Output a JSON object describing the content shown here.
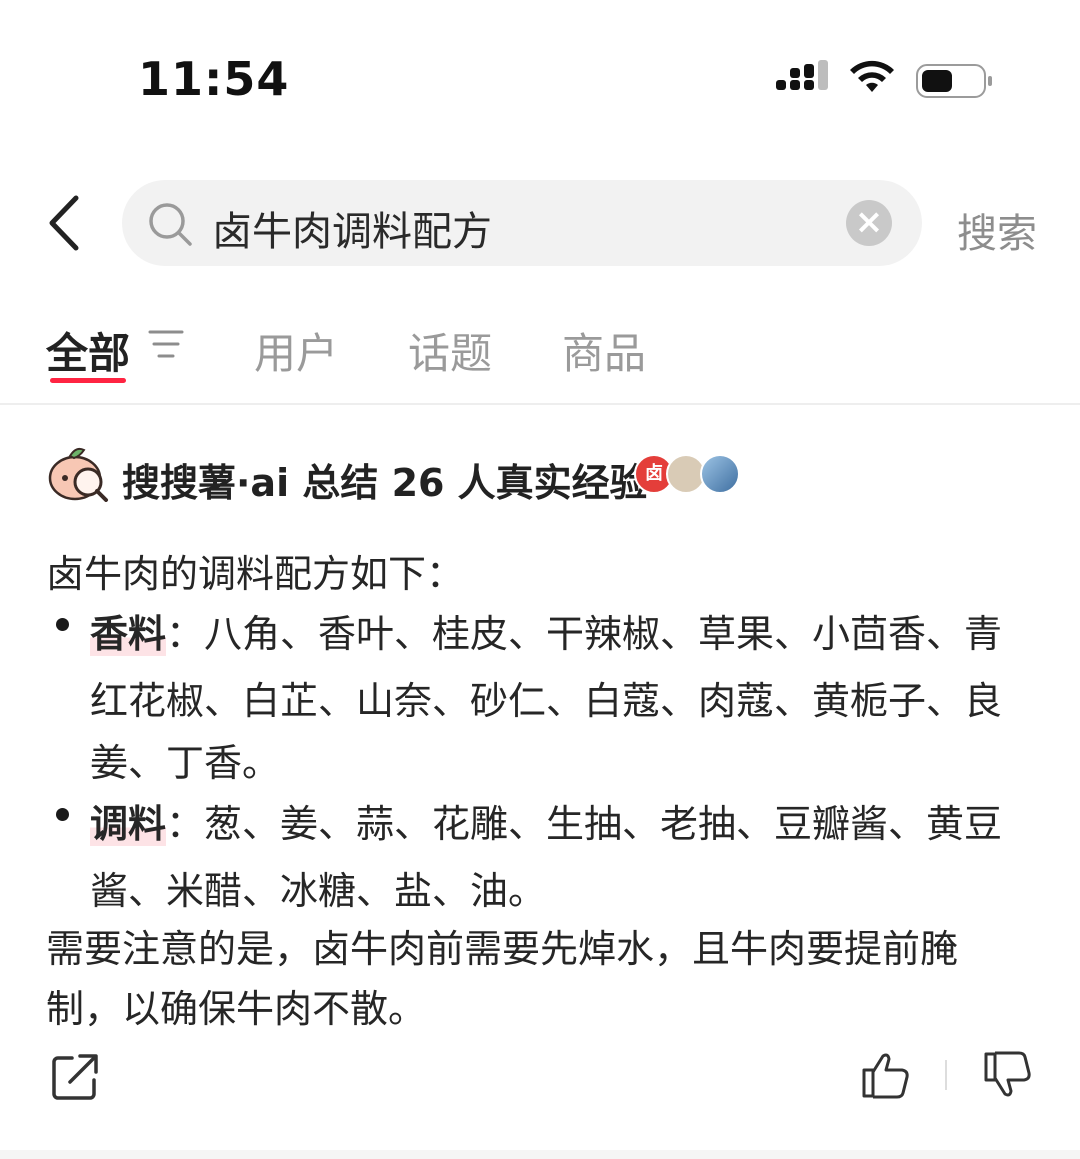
{
  "status_bar": {
    "time": "11:54"
  },
  "search": {
    "query": "卤牛肉调料配方",
    "clear_icon": "×",
    "submit_label": "搜索"
  },
  "tabs": [
    {
      "label": "全部",
      "active": true
    },
    {
      "label": "用户",
      "active": false
    },
    {
      "label": "话题",
      "active": false
    },
    {
      "label": "商品",
      "active": false
    }
  ],
  "ai_summary": {
    "title": "搜搜薯·ai 总结 26 人真实经验",
    "avatar1_text": "卤",
    "intro": "卤牛肉的调料配方如下：",
    "bullets": [
      {
        "keyword": "香料",
        "lines": [
          "：八角、香叶、桂皮、干辣椒、草果、小茴香、青",
          "红花椒、白芷、山奈、砂仁、白蔻、肉蔻、黄栀子、良",
          "姜、丁香。"
        ]
      },
      {
        "keyword": "调料",
        "lines": [
          "：葱、姜、蒜、花雕、生抽、老抽、豆瓣酱、黄豆",
          "酱、米醋、冰糖、盐、油。"
        ]
      }
    ],
    "note_lines": [
      "需要注意的是，卤牛肉前需要先焯水，且牛肉要提前腌",
      "制，以确保牛肉不散。"
    ]
  },
  "colors": {
    "accent": "#ff2442",
    "search_bg": "#f2f2f2",
    "muted_text": "#9a9a9a"
  },
  "icons": [
    "back-icon",
    "search-icon",
    "clear-icon",
    "filter-icon",
    "ai-logo-icon",
    "share-icon",
    "thumbs-up-icon",
    "thumbs-down-icon"
  ]
}
